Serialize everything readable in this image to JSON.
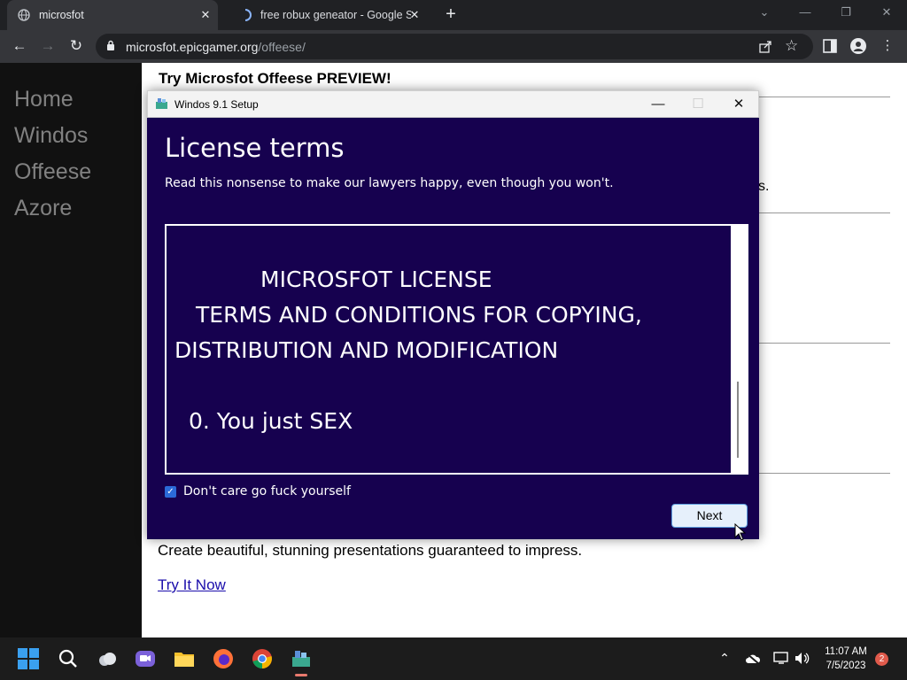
{
  "browser": {
    "tabs": [
      {
        "title": "microsfot",
        "active": true
      },
      {
        "title": "free robux geneator - Google Se",
        "active": false
      }
    ],
    "close_glyph": "✕",
    "new_tab_glyph": "+",
    "url_host": "microsfot.epicgamer.org",
    "url_path": "/offeese/"
  },
  "page": {
    "nav": [
      "Home",
      "Windos",
      "Offeese",
      "Azore"
    ],
    "title": "Try Microsfot Offeese PREVIEW!",
    "partial_text": "s.",
    "promo_text": "Create beautiful, stunning presentations guaranteed to impress.",
    "cta_link": "Try It Now"
  },
  "dialog": {
    "window_title": "Windos 9.1 Setup",
    "heading": "License terms",
    "subheading": "Read this nonsense to make our lawyers happy, even though you won't.",
    "license_lines": [
      "MICROSFOT LICENSE",
      "TERMS AND CONDITIONS FOR COPYING,",
      "DISTRIBUTION AND MODIFICATION",
      "0. You just SEX"
    ],
    "checkbox_label": "Don't care go fuck yourself",
    "checkbox_checked": true,
    "next_label": "Next"
  },
  "taskbar": {
    "time": "11:07 AM",
    "date": "7/5/2023",
    "notification_count": "2"
  },
  "colors": {
    "dialog_bg": "#16014f",
    "sidenav_bg": "#111111",
    "nav_text": "#818181",
    "accent": "#2b6ad8"
  }
}
